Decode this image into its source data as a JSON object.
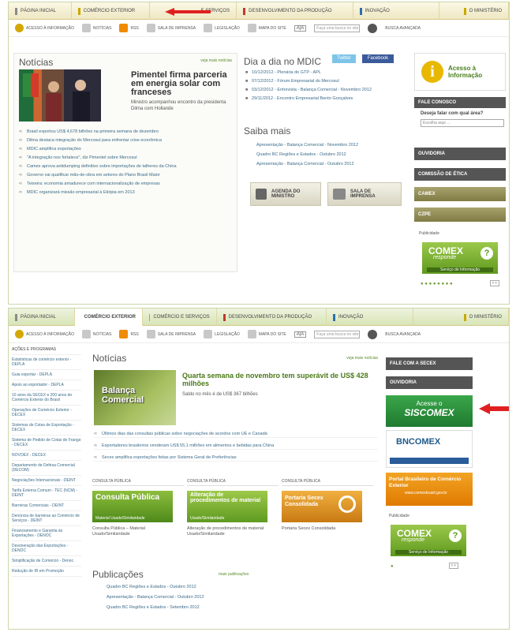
{
  "s1": {
    "topnav": [
      {
        "label": "Página Inicial",
        "color": "#8a8a8a"
      },
      {
        "label": "Comércio Exterior",
        "color": "#c9a800"
      },
      {
        "label": "e Serviços",
        "color": "#c9a800"
      },
      {
        "label": "Desenvolvimento da Produção",
        "color": "#c0392b"
      },
      {
        "label": "Inovação",
        "color": "#2a6fb0"
      },
      {
        "label": "O Ministério",
        "color": "#c9a800"
      }
    ],
    "subnav": [
      "Acesso à Informação",
      "Notícias",
      "RSS",
      "Sala de Imprensa",
      "Legislação",
      "Mapa do Site"
    ],
    "search_placeholder": "Faça uma busca no site",
    "busca_avancada": "Busca avançada",
    "aa": "A|A",
    "noticias_title": "Notícias",
    "veja_mais": "veja mais notícias",
    "headline": "Pimentel firma parceria em energia solar com franceses",
    "headline_sub": "Ministro acompanhou encontro da presidenta Dilma com Hollande",
    "news": [
      "Brasil exportou US$ 4,678 bilhões na primeira semana de dezembro",
      "Dilma destaca integração do Mercosul para enfrentar crise econômica",
      "MDIC amplifica exportações",
      "\"A integração nos fortalece\", diz Pimentel sobre Mercosul",
      "Camex aprova antidumping definitivo sobre importações de talheres da China",
      "Governo vai qualificar mão-de-obra em setores do Plano Brasil Maior",
      "Teixeira: economia amadurece com internacionalização de empresas",
      "MDIC organizará missão empresarial à Etiópia em 2013"
    ],
    "dia_title": "Dia a dia no MDIC",
    "twitter": "Twitter",
    "facebook": "Facebook",
    "dia_items": [
      "10/12/2012 - Plenária do GTP - APL",
      "07/12/2012 - Fórum Empresarial do Mercosul",
      "03/12/2012 - Entrevista - Balança Comercial - Novembro 2012",
      "29/11/2012 - Encontro Empresarial Bento Gonçalves"
    ],
    "saiba_title": "Saiba mais",
    "saiba_items": [
      "Apresentação - Balança Comercial - Novembro 2012",
      "Quadro BC Regiões e Estados - Outubro 2012",
      "Apresentação - Balança Comercial - Outubro 2012"
    ],
    "agenda": "Agenda do Ministro",
    "sala": "Sala de Imprensa",
    "acesso_info": "Acesso à Informação",
    "fale": "Fale Conosco",
    "deseja": "Deseja falar com qual área?",
    "escolha": "Escolha aqui ...",
    "ouvidoria": "Ouvidoria",
    "etica": "Comissão de Ética",
    "camex": "Camex",
    "czpe": "CZPE",
    "publicidade": "Publicidade",
    "comex": "COMEX",
    "responde": "responde",
    "servico": "Serviço de Informação"
  },
  "s2": {
    "topnav": [
      {
        "label": "Página Inicial",
        "color": "#8a8a8a"
      },
      {
        "label": "Comércio Exterior",
        "color": "#c9a800"
      },
      {
        "label": "Comércio e Serviços",
        "color": "#c9a800"
      },
      {
        "label": "Desenvolvimento da Produção",
        "color": "#c0392b"
      },
      {
        "label": "Inovação",
        "color": "#2a6fb0"
      },
      {
        "label": "O Ministério",
        "color": "#c9a800"
      }
    ],
    "subnav": [
      "Acesso à Informação",
      "Notícias",
      "RSS",
      "Sala de Imprensa",
      "Legislação",
      "Mapa do Site"
    ],
    "search_placeholder": "Faça uma busca no site",
    "busca_avancada": "Busca avançada",
    "aa": "A|A",
    "side": [
      "Ações e Programas",
      "Estatísticas de comércio exterior - DEPLA",
      "Guia exportar - DEPLA",
      "Apoio ao exportador - DEPLA",
      "10 anos da SECEX e 200 anos do Comércio Exterior do Brasil",
      "Operações de Comércio Exterior - DECEX",
      "Sistemas de Cotas de Exportação - DECEX",
      "Sistema de Pedido de Cotas de Frango - DECEX",
      "NOVOEX - DECEX",
      "Departamento de Defesa Comercial (DECOM)",
      "Negociações Internacionais - DEINT",
      "Tarifa Externa Comum - TEC (NCM) - DEINT",
      "Barreiras Comerciais - DEINT",
      "Denúncia de barreiras ao Comércio de Serviços - DEINT",
      "Financiamento e Garantia às Exportações - DENOC",
      "Desoneração das Exportações - DENOC",
      "Simplificação de Comércio - Denoc",
      "Redução de IR em Promoção"
    ],
    "noticias_title": "Notícias",
    "veja_mais": "veja mais notícias",
    "balanca": "Balança Comercial",
    "headline": "Quarta semana de novembro tem superávit de US$ 428 milhões",
    "headline_sub": "Saldo no mês é de US$ 367 bilhões",
    "news": [
      "Últimos dias das consultas públicas sobre negociações de acordos com UE e Canadá",
      "Exportadores brasileiros venderam US$ 55,1 milhões em alimentos e bebidas para China",
      "Secex amplifica exportações feitas por Sistema Geral de Preferências"
    ],
    "consulta_head": "Consulta Pública",
    "cp1_img": "Consulta Pública",
    "cp1_img_sub": "Material Usado/Similaridade",
    "cp1_cap": "Consulta Pública – Material Usado/Similaridade",
    "cp2_img": "Alteração de procedimentos de material",
    "cp2_img_sub": "Usado/Similaridade",
    "cp2_cap": "Alteração de procedimentos de material Usado/Similaridade",
    "cp3_img": "Portaria Secex Consolidada",
    "cp3_cap": "Portaria Secex Consolidada",
    "pub_title": "Publicações",
    "mais_pub": "mais publicações",
    "pub_items": [
      "Quadro BC Regiões e Estados - Outubro 2012",
      "Apresentação - Balança Comercial - Outubro 2012",
      "Quadro BC Regiões e Estados - Setembro 2012"
    ],
    "fale_secex": "Fale com a SECEX",
    "ouvidoria": "Ouvidoria",
    "acesso": "Acesse o",
    "siscomex": "SISCOMEX",
    "bncomex": "BNCOMEX",
    "portal": "Portal Brasileiro de Comércio Exterior",
    "portal_url": "www.comexbrasil.gov.br",
    "publicidade": "Publicidade",
    "comex": "COMEX",
    "responde": "responde",
    "servico": "Serviço de Informação"
  }
}
